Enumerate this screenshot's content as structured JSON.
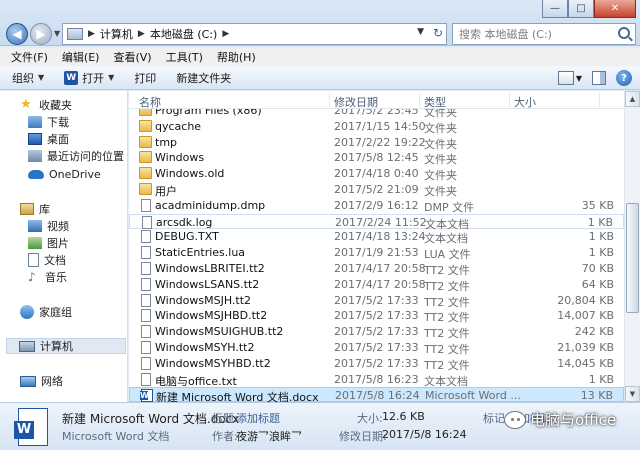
{
  "window": {
    "minimize": "—",
    "maximize": "□",
    "close": "✕"
  },
  "address": {
    "parts": [
      "计算机",
      "本地磁盘 (C:)"
    ],
    "search_placeholder": "搜索 本地磁盘 (C:)"
  },
  "menu": [
    "文件(F)",
    "编辑(E)",
    "查看(V)",
    "工具(T)",
    "帮助(H)"
  ],
  "toolbar": {
    "organize": "组织",
    "open": "打开",
    "print": "打印",
    "new_folder": "新建文件夹"
  },
  "nav": {
    "favorites": "收藏夹",
    "downloads": "下载",
    "desktop": "桌面",
    "recent": "最近访问的位置",
    "onedrive": "OneDrive",
    "libraries": "库",
    "videos": "视频",
    "pictures": "图片",
    "documents": "文档",
    "music": "音乐",
    "homegroup": "家庭组",
    "computer": "计算机",
    "network": "网络"
  },
  "columns": {
    "name": "名称",
    "date": "修改日期",
    "type": "类型",
    "size": "大小"
  },
  "files": [
    {
      "name": "Program Files (x86)",
      "date": "2017/5/2 23:45",
      "type": "文件夹",
      "size": "",
      "kind": "folder"
    },
    {
      "name": "qycache",
      "date": "2017/1/15 14:50",
      "type": "文件夹",
      "size": "",
      "kind": "folder"
    },
    {
      "name": "tmp",
      "date": "2017/2/22 19:22",
      "type": "文件夹",
      "size": "",
      "kind": "folder"
    },
    {
      "name": "Windows",
      "date": "2017/5/8 12:45",
      "type": "文件夹",
      "size": "",
      "kind": "folder"
    },
    {
      "name": "Windows.old",
      "date": "2017/4/18 0:40",
      "type": "文件夹",
      "size": "",
      "kind": "folder"
    },
    {
      "name": "用户",
      "date": "2017/5/2 21:09",
      "type": "文件夹",
      "size": "",
      "kind": "folder"
    },
    {
      "name": "acadminidump.dmp",
      "date": "2017/2/9 16:12",
      "type": "DMP 文件",
      "size": "35 KB",
      "kind": "file"
    },
    {
      "name": "arcsdk.log",
      "date": "2017/2/24 11:52",
      "type": "文本文档",
      "size": "1 KB",
      "kind": "file"
    },
    {
      "name": "DEBUG.TXT",
      "date": "2017/4/18 13:24",
      "type": "文本文档",
      "size": "1 KB",
      "kind": "file"
    },
    {
      "name": "StaticEntries.lua",
      "date": "2017/1/9 21:53",
      "type": "LUA 文件",
      "size": "1 KB",
      "kind": "file"
    },
    {
      "name": "WindowsLBRITEI.tt2",
      "date": "2017/4/17 20:58",
      "type": "TT2 文件",
      "size": "70 KB",
      "kind": "file"
    },
    {
      "name": "WindowsLSANS.tt2",
      "date": "2017/4/17 20:58",
      "type": "TT2 文件",
      "size": "64 KB",
      "kind": "file"
    },
    {
      "name": "WindowsMSJH.tt2",
      "date": "2017/5/2 17:33",
      "type": "TT2 文件",
      "size": "20,804 KB",
      "kind": "file"
    },
    {
      "name": "WindowsMSJHBD.tt2",
      "date": "2017/5/2 17:33",
      "type": "TT2 文件",
      "size": "14,007 KB",
      "kind": "file"
    },
    {
      "name": "WindowsMSUIGHUB.tt2",
      "date": "2017/5/2 17:33",
      "type": "TT2 文件",
      "size": "242 KB",
      "kind": "file"
    },
    {
      "name": "WindowsMSYH.tt2",
      "date": "2017/5/2 17:33",
      "type": "TT2 文件",
      "size": "21,039 KB",
      "kind": "file"
    },
    {
      "name": "WindowsMSYHBD.tt2",
      "date": "2017/5/2 17:33",
      "type": "TT2 文件",
      "size": "14,045 KB",
      "kind": "file"
    },
    {
      "name": "电脑与office.txt",
      "date": "2017/5/8 16:23",
      "type": "文本文档",
      "size": "1 KB",
      "kind": "file"
    },
    {
      "name": "新建 Microsoft Word 文档.docx",
      "date": "2017/5/8 16:24",
      "type": "Microsoft Word ...",
      "size": "13 KB",
      "kind": "word"
    }
  ],
  "details": {
    "filename": "新建 Microsoft Word 文档.docx",
    "filetype": "Microsoft Word 文档",
    "title_label": "标题:",
    "title_value": "添加标题",
    "author_label": "作者:",
    "author_value": "夜游乛浪眸乛",
    "size_label": "大小:",
    "size_value": "12.6 KB",
    "modified_label": "修改日期:",
    "modified_value": "2017/5/8 16:24",
    "tags_label": "标记:",
    "tags_value": "添加标记"
  },
  "watermark": "电脑与office"
}
